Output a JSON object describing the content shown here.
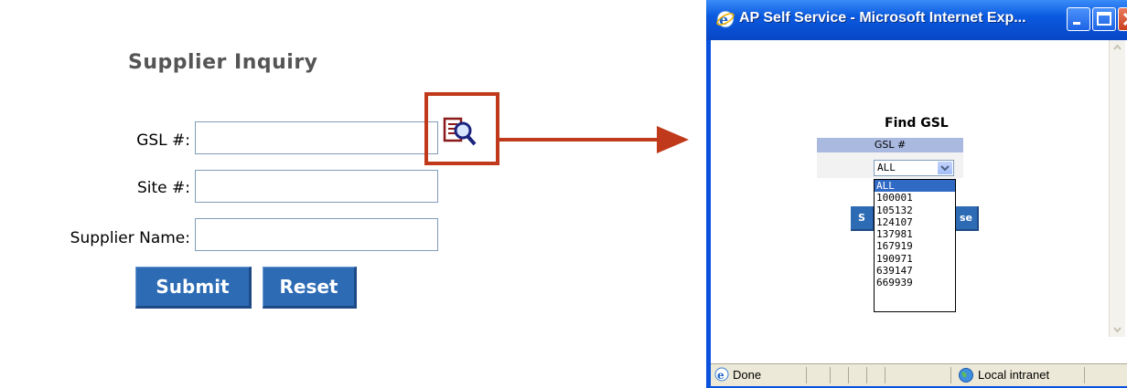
{
  "form": {
    "title": "Supplier Inquiry",
    "gsl_label": "GSL #:",
    "site_label": "Site #:",
    "supplier_label": "Supplier Name:",
    "gsl_value": "",
    "site_value": "",
    "supplier_value": "",
    "submit_label": "Submit",
    "reset_label": "Reset",
    "lookup_icon": "magnifier-lookup-icon"
  },
  "popup": {
    "window_title": "AP Self Service - Microsoft Internet Exp...",
    "heading": "Find GSL",
    "column_header": "GSL #",
    "selected_value": "ALL",
    "options": [
      "ALL",
      "100001",
      "105132",
      "124107",
      "137981",
      "167919",
      "190971",
      "639147",
      "669939"
    ],
    "button1_partial": "S",
    "button2_partial": "se",
    "status_text": "Done",
    "zone_text": "Local intranet"
  },
  "colors": {
    "button_blue": "#2d6bb4",
    "highlight_red": "#c0391a",
    "xp_title_blue": "#0a52dd",
    "grid_header": "#a9b9e0"
  }
}
